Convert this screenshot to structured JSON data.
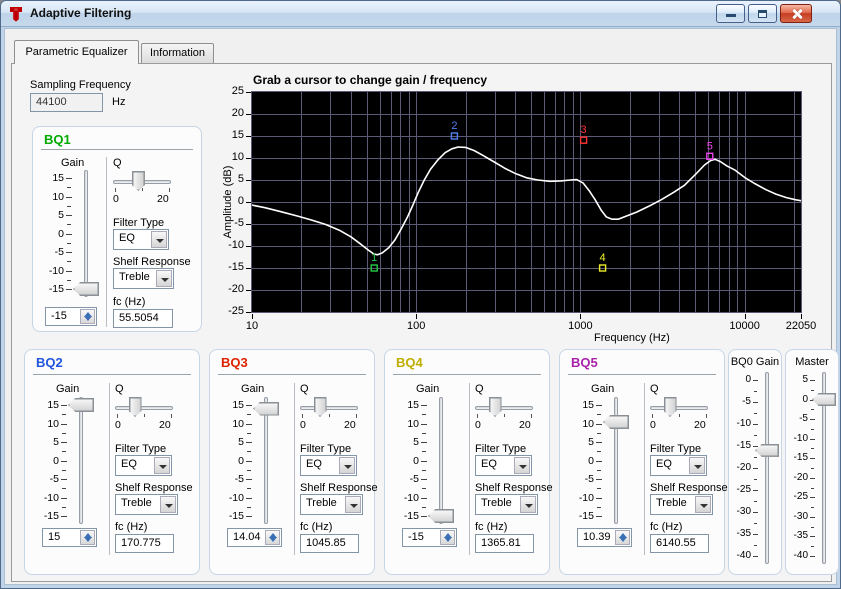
{
  "window": {
    "title": "Adaptive Filtering"
  },
  "tabs": [
    {
      "label": "Parametric Equalizer",
      "active": true
    },
    {
      "label": "Information",
      "active": false
    }
  ],
  "sampling_frequency": {
    "label": "Sampling Frequency",
    "value": "44100",
    "unit": "Hz"
  },
  "chart_data": {
    "type": "line",
    "title": "Grab a cursor to change gain / frequency",
    "xlabel": "Frequency (Hz)",
    "ylabel": "Amplitude (dB)",
    "x_scale": "log",
    "xlim": [
      10,
      22050
    ],
    "ylim": [
      -25,
      25
    ],
    "x_tick_values": [
      10,
      100,
      1000,
      10000,
      22050
    ],
    "x_tick_labels": [
      "10",
      "100",
      "1000",
      "10000",
      "22050"
    ],
    "y_tick_values": [
      25,
      20,
      15,
      10,
      5,
      0,
      -5,
      -10,
      -15,
      -20,
      -25
    ],
    "grid": true,
    "colors": {
      "plot_bg": "#000000",
      "grid": "#5b5b77",
      "curve": "#ffffff"
    },
    "series": [
      {
        "name": "frequency-response",
        "points": [
          [
            10,
            -0.7
          ],
          [
            12,
            -1.3
          ],
          [
            15,
            -2.2
          ],
          [
            19,
            -3.2
          ],
          [
            23,
            -4.1
          ],
          [
            28,
            -5.1
          ],
          [
            34,
            -6.4
          ],
          [
            40,
            -7.9
          ],
          [
            46,
            -9.6
          ],
          [
            51,
            -10.9
          ],
          [
            55,
            -11.8
          ],
          [
            58,
            -12.0
          ],
          [
            62,
            -11.6
          ],
          [
            68,
            -10.4
          ],
          [
            74,
            -8.7
          ],
          [
            80,
            -6.5
          ],
          [
            88,
            -3.6
          ],
          [
            95,
            -0.9
          ],
          [
            103,
            2.2
          ],
          [
            112,
            5.0
          ],
          [
            122,
            7.4
          ],
          [
            135,
            9.5
          ],
          [
            150,
            11.2
          ],
          [
            165,
            12.1
          ],
          [
            180,
            12.5
          ],
          [
            200,
            12.4
          ],
          [
            225,
            11.7
          ],
          [
            255,
            10.6
          ],
          [
            295,
            9.2
          ],
          [
            345,
            7.7
          ],
          [
            405,
            6.4
          ],
          [
            470,
            5.5
          ],
          [
            550,
            5.0
          ],
          [
            650,
            4.7
          ],
          [
            760,
            4.8
          ],
          [
            870,
            5.0
          ],
          [
            950,
            5.1
          ],
          [
            1040,
            4.3
          ],
          [
            1130,
            2.6
          ],
          [
            1230,
            0.5
          ],
          [
            1340,
            -1.9
          ],
          [
            1440,
            -3.4
          ],
          [
            1560,
            -3.9
          ],
          [
            1700,
            -3.9
          ],
          [
            1900,
            -3.2
          ],
          [
            2200,
            -2.3
          ],
          [
            2600,
            -1.0
          ],
          [
            3100,
            0.5
          ],
          [
            3700,
            2.2
          ],
          [
            4300,
            3.8
          ],
          [
            5000,
            6.2
          ],
          [
            5700,
            8.4
          ],
          [
            6200,
            9.4
          ],
          [
            6600,
            9.7
          ],
          [
            7100,
            9.2
          ],
          [
            7800,
            8.2
          ],
          [
            8700,
            7.3
          ],
          [
            10000,
            5.6
          ],
          [
            11500,
            4.2
          ],
          [
            13500,
            2.8
          ],
          [
            15500,
            1.8
          ],
          [
            18000,
            1.0
          ],
          [
            20500,
            0.5
          ],
          [
            22050,
            0.3
          ]
        ]
      }
    ],
    "cursors": [
      {
        "label": "1",
        "freq": 55.5054,
        "gain_db": -15,
        "color": "#22cc44"
      },
      {
        "label": "2",
        "freq": 170.775,
        "gain_db": 15,
        "color": "#4f81f0"
      },
      {
        "label": "3",
        "freq": 1045.85,
        "gain_db": 14.04,
        "color": "#ff3333"
      },
      {
        "label": "4",
        "freq": 1365.81,
        "gain_db": -15,
        "color": "#eded2a"
      },
      {
        "label": "5",
        "freq": 6140.55,
        "gain_db": 10.39,
        "color": "#ee44ee"
      }
    ]
  },
  "bq_common": {
    "gain_label": "Gain",
    "q_label": "Q",
    "q_min_label": "0",
    "q_max_label": "20",
    "filter_type_label": "Filter Type",
    "shelf_label": "Shelf Response",
    "fc_label": "fc (Hz)"
  },
  "bq_panels": [
    {
      "title": "BQ1",
      "title_color": "#00aa00",
      "gain_value": "-15",
      "gain_slider": -15,
      "gain_min": -15,
      "gain_max": 15,
      "gain_ticks": [
        "15",
        "10",
        "5",
        "0",
        "-5",
        "-10",
        "-15"
      ],
      "q_frac": 0.42,
      "filter_type": "EQ",
      "shelf_response": "Treble",
      "fc": "55.5054"
    },
    {
      "title": "BQ2",
      "title_color": "#2255dd",
      "gain_value": "15",
      "gain_slider": 15,
      "gain_min": -15,
      "gain_max": 15,
      "gain_ticks": [
        "15",
        "10",
        "5",
        "0",
        "-5",
        "-10",
        "-15"
      ],
      "q_frac": 0.3,
      "filter_type": "EQ",
      "shelf_response": "Treble",
      "fc": "170.775"
    },
    {
      "title": "BQ3",
      "title_color": "#dd2200",
      "gain_value": "14.04",
      "gain_slider": 14.04,
      "gain_min": -15,
      "gain_max": 15,
      "gain_ticks": [
        "15",
        "10",
        "5",
        "0",
        "-5",
        "-10",
        "-15"
      ],
      "q_frac": 0.3,
      "filter_type": "EQ",
      "shelf_response": "Treble",
      "fc": "1045.85"
    },
    {
      "title": "BQ4",
      "title_color": "#bfae00",
      "gain_value": "-15",
      "gain_slider": -15,
      "gain_min": -15,
      "gain_max": 15,
      "gain_ticks": [
        "15",
        "10",
        "5",
        "0",
        "-5",
        "-10",
        "-15"
      ],
      "q_frac": 0.3,
      "filter_type": "EQ",
      "shelf_response": "Treble",
      "fc": "1365.81"
    },
    {
      "title": "BQ5",
      "title_color": "#aa22aa",
      "gain_value": "10.39",
      "gain_slider": 10.39,
      "gain_min": -15,
      "gain_max": 15,
      "gain_ticks": [
        "15",
        "10",
        "5",
        "0",
        "-5",
        "-10",
        "-15"
      ],
      "q_frac": 0.3,
      "filter_type": "EQ",
      "shelf_response": "Treble",
      "fc": "6140.55"
    }
  ],
  "bq0_gain": {
    "title": "BQ0 Gain",
    "min": -40,
    "max": 0,
    "value": -16,
    "ticks": [
      "0",
      "-5",
      "-10",
      "-15",
      "-20",
      "-25",
      "-30",
      "-35",
      "-40"
    ]
  },
  "master": {
    "title": "Master",
    "min": -40,
    "max": 5,
    "value": 0,
    "ticks": [
      "5",
      "0",
      "-5",
      "-10",
      "-15",
      "-20",
      "-25",
      "-30",
      "-35",
      "-40"
    ]
  }
}
